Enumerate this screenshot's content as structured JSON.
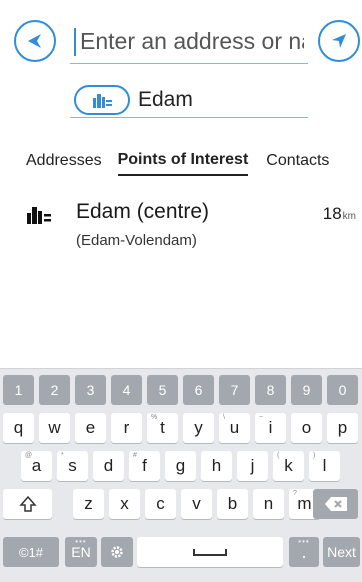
{
  "search": {
    "placeholder": "Enter an address or name",
    "filter_text": "Edam"
  },
  "tabs": [
    {
      "label": "Addresses",
      "active": false
    },
    {
      "label": "Points of Interest",
      "active": true
    },
    {
      "label": "Contacts",
      "active": false
    }
  ],
  "results": [
    {
      "title": "Edam (centre)",
      "subtitle": "(Edam-Volendam)",
      "distance": "18",
      "unit": "km"
    }
  ],
  "colors": {
    "accent": "#2f8ddb",
    "keyboard_bg": "#e6e8eb",
    "key_dark": "#a3a8ae"
  },
  "keyboard": {
    "numbers": [
      "1",
      "2",
      "3",
      "4",
      "5",
      "6",
      "7",
      "8",
      "9",
      "0"
    ],
    "row1": [
      "q",
      "w",
      "e",
      "r",
      "t",
      "y",
      "u",
      "i",
      "o",
      "p"
    ],
    "row1_hints": [
      "",
      "",
      "",
      "",
      "%",
      "",
      "\\",
      "~",
      "",
      ""
    ],
    "row2": [
      "a",
      "s",
      "d",
      "f",
      "g",
      "h",
      "j",
      "k",
      "l"
    ],
    "row2_hints": [
      "@",
      "*",
      "",
      "#",
      "",
      "",
      "",
      "(",
      ")"
    ],
    "row3": [
      "z",
      "x",
      "c",
      "v",
      "b",
      "n",
      "m"
    ],
    "row3_hints": [
      "",
      "",
      "",
      "",
      "",
      "",
      "?"
    ],
    "symbols_label": "©1#",
    "lang_label": "EN",
    "period_label": ".",
    "next_label": "Next",
    "shift_icon": "shift-icon",
    "backspace_icon": "backspace-icon",
    "settings_icon": "gear-icon",
    "space_icon": "space-bar-icon"
  }
}
